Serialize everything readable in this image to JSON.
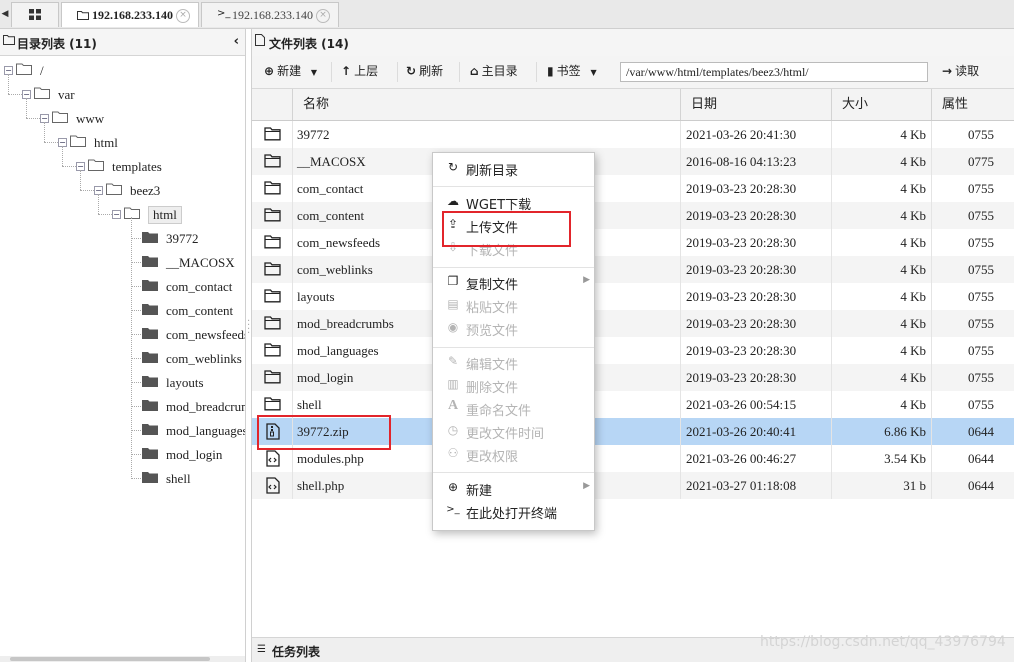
{
  "tabs": [
    {
      "label": "192.168.233.140",
      "icon": "folder-icon",
      "active": true
    },
    {
      "label": "192.168.233.140",
      "icon": "terminal-icon",
      "active": false
    }
  ],
  "left_panel": {
    "title": "目录列表 (11)",
    "tree": [
      {
        "label": "/",
        "level": 0
      },
      {
        "label": "var",
        "level": 1
      },
      {
        "label": "www",
        "level": 2
      },
      {
        "label": "html",
        "level": 3
      },
      {
        "label": "templates",
        "level": 4
      },
      {
        "label": "beez3",
        "level": 5
      },
      {
        "label": "html",
        "level": 6,
        "selected": true
      }
    ],
    "children": [
      "39772",
      "__MACOSX",
      "com_contact",
      "com_content",
      "com_newsfeeds",
      "com_weblinks",
      "layouts",
      "mod_breadcrumbs",
      "mod_languages",
      "mod_login",
      "shell"
    ]
  },
  "right_panel": {
    "title": "文件列表 (14)",
    "toolbar": {
      "new": "新建",
      "up": "上层",
      "refresh": "刷新",
      "home": "主目录",
      "bookmark": "书签",
      "path": "/var/www/html/templates/beez3/html/",
      "read": "读取"
    },
    "columns": {
      "name": "名称",
      "date": "日期",
      "size": "大小",
      "attr": "属性"
    },
    "files": [
      {
        "name": "39772",
        "date": "2021-03-26 20:41:30",
        "size": "4 Kb",
        "attr": "0755",
        "type": "folder"
      },
      {
        "name": "__MACOSX",
        "date": "2016-08-16 04:13:23",
        "size": "4 Kb",
        "attr": "0775",
        "type": "folder"
      },
      {
        "name": "com_contact",
        "date": "2019-03-23 20:28:30",
        "size": "4 Kb",
        "attr": "0755",
        "type": "folder"
      },
      {
        "name": "com_content",
        "date": "2019-03-23 20:28:30",
        "size": "4 Kb",
        "attr": "0755",
        "type": "folder"
      },
      {
        "name": "com_newsfeeds",
        "date": "2019-03-23 20:28:30",
        "size": "4 Kb",
        "attr": "0755",
        "type": "folder"
      },
      {
        "name": "com_weblinks",
        "date": "2019-03-23 20:28:30",
        "size": "4 Kb",
        "attr": "0755",
        "type": "folder"
      },
      {
        "name": "layouts",
        "date": "2019-03-23 20:28:30",
        "size": "4 Kb",
        "attr": "0755",
        "type": "folder"
      },
      {
        "name": "mod_breadcrumbs",
        "date": "2019-03-23 20:28:30",
        "size": "4 Kb",
        "attr": "0755",
        "type": "folder"
      },
      {
        "name": "mod_languages",
        "date": "2019-03-23 20:28:30",
        "size": "4 Kb",
        "attr": "0755",
        "type": "folder"
      },
      {
        "name": "mod_login",
        "date": "2019-03-23 20:28:30",
        "size": "4 Kb",
        "attr": "0755",
        "type": "folder"
      },
      {
        "name": "shell",
        "date": "2021-03-26 00:54:15",
        "size": "4 Kb",
        "attr": "0755",
        "type": "folder"
      },
      {
        "name": "39772.zip",
        "date": "2021-03-26 20:40:41",
        "size": "6.86 Kb",
        "attr": "0644",
        "type": "zip",
        "selected": true
      },
      {
        "name": "modules.php",
        "date": "2021-03-26 00:46:27",
        "size": "3.54 Kb",
        "attr": "0644",
        "type": "code"
      },
      {
        "name": "shell.php",
        "date": "2021-03-27 01:18:08",
        "size": "31 b",
        "attr": "0644",
        "type": "code"
      }
    ],
    "task_title": "任务列表"
  },
  "context_menu": {
    "refresh": "刷新目录",
    "wget": "WGET下载",
    "upload": "上传文件",
    "download": "下载文件",
    "copy": "复制文件",
    "paste": "粘贴文件",
    "preview": "预览文件",
    "edit": "编辑文件",
    "delete": "删除文件",
    "rename": "重命名文件",
    "chtime": "更改文件时间",
    "chmod": "更改权限",
    "new": "新建",
    "terminal": "在此处打开终端"
  },
  "watermark": "https://blog.csdn.net/qq_43976794",
  "colors": {
    "selected_row": "#b7d6f5",
    "highlight_box": "#e2252b"
  }
}
